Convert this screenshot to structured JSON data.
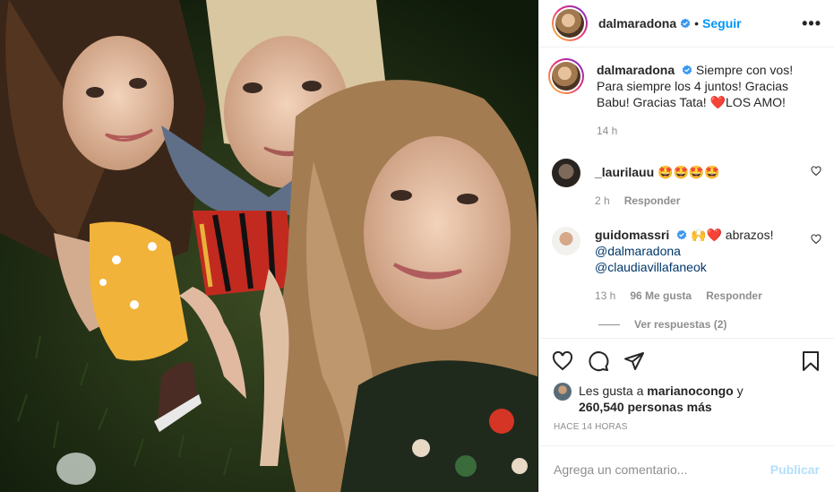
{
  "post": {
    "username": "dalmaradona",
    "separator": "•",
    "follow_label": "Seguir",
    "more_label": "•••",
    "caption": {
      "username": "dalmaradona",
      "text": "Siempre con vos! Para siempre los 4 juntos! Gracias Babu! Gracias Tata! ❤️LOS AMO!",
      "time": "14 h"
    }
  },
  "comments": [
    {
      "username": "_laurilauu",
      "text": "🤩🤩🤩🤩",
      "time": "2 h",
      "reply_label": "Responder"
    },
    {
      "username": "guidomassri",
      "text": "🙌❤️ abrazos!",
      "mentions": [
        "@dalmaradona",
        "@claudiavillafaneok"
      ],
      "time": "13 h",
      "likes_label": "96 Me gusta",
      "reply_label": "Responder",
      "view_replies_label": "Ver respuestas (2)"
    }
  ],
  "likes": {
    "prefix": "Les gusta a",
    "user": "marianocongo",
    "conjunction": "y",
    "count_label": "260,540 personas más"
  },
  "timestamp": "HACE 14 HORAS",
  "add_comment": {
    "placeholder": "Agrega un comentario...",
    "publish_label": "Publicar"
  },
  "colors": {
    "link_blue": "#0095f6",
    "publish_disabled": "#b2dffc",
    "muted_gray": "#8e8e8e",
    "verified_blue": "#3897f0",
    "heart_red": "#ed4956"
  },
  "icons": [
    "verified-badge-icon",
    "more-options-icon",
    "heart-icon",
    "comment-icon",
    "share-icon",
    "bookmark-icon"
  ]
}
